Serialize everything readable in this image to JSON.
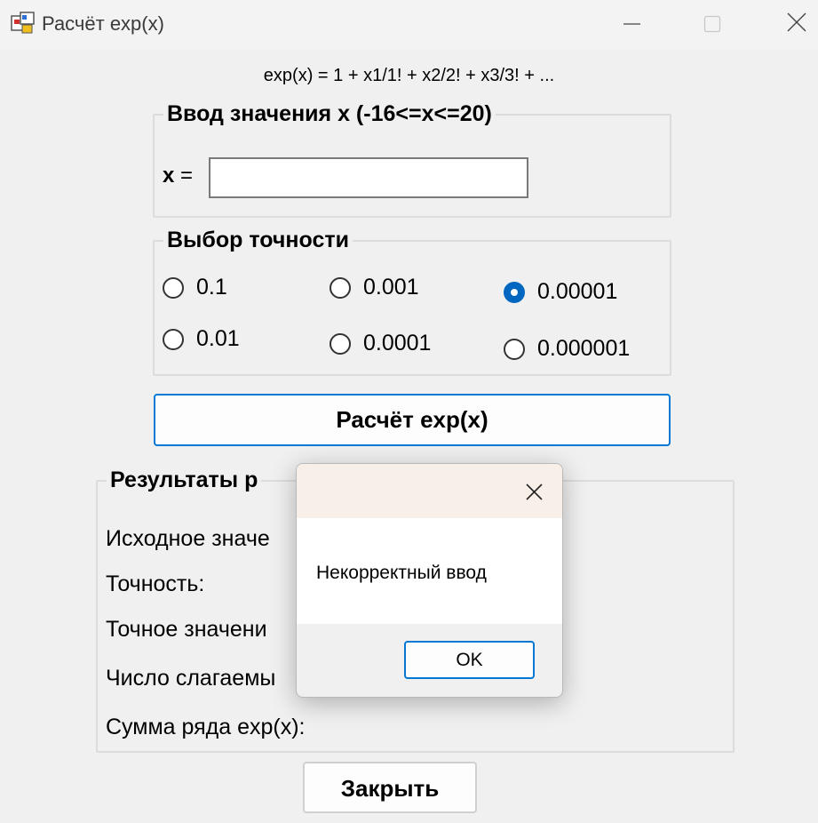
{
  "window": {
    "title": "Расчёт exp(x)",
    "icon": "app-icon",
    "accent": "#0067c0"
  },
  "formula": "exp(x) = 1 + x1/1! + x2/2! + x3/3! + ...",
  "input_group": {
    "legend": "Ввод значения x (-16<=x<=20)",
    "x_label_var": "x",
    "x_label_eq": " =",
    "x_value": ""
  },
  "precision_group": {
    "legend": "Выбор точности",
    "options": [
      {
        "label": "0.1",
        "checked": false
      },
      {
        "label": "0.01",
        "checked": false
      },
      {
        "label": "0.001",
        "checked": false
      },
      {
        "label": "0.0001",
        "checked": false
      },
      {
        "label": "0.00001",
        "checked": true
      },
      {
        "label": "0.000001",
        "checked": false
      }
    ]
  },
  "calc_button": "Расчёт exp(x)",
  "results_group": {
    "legend": "Результаты р",
    "lines": [
      "Исходное значе",
      "Точность:",
      "Точное значени",
      "Число слагаемы",
      "Сумма ряда exp(x):"
    ]
  },
  "close_button": "Закрыть",
  "dialog": {
    "message": "Некорректный ввод",
    "ok_button": "OK"
  }
}
